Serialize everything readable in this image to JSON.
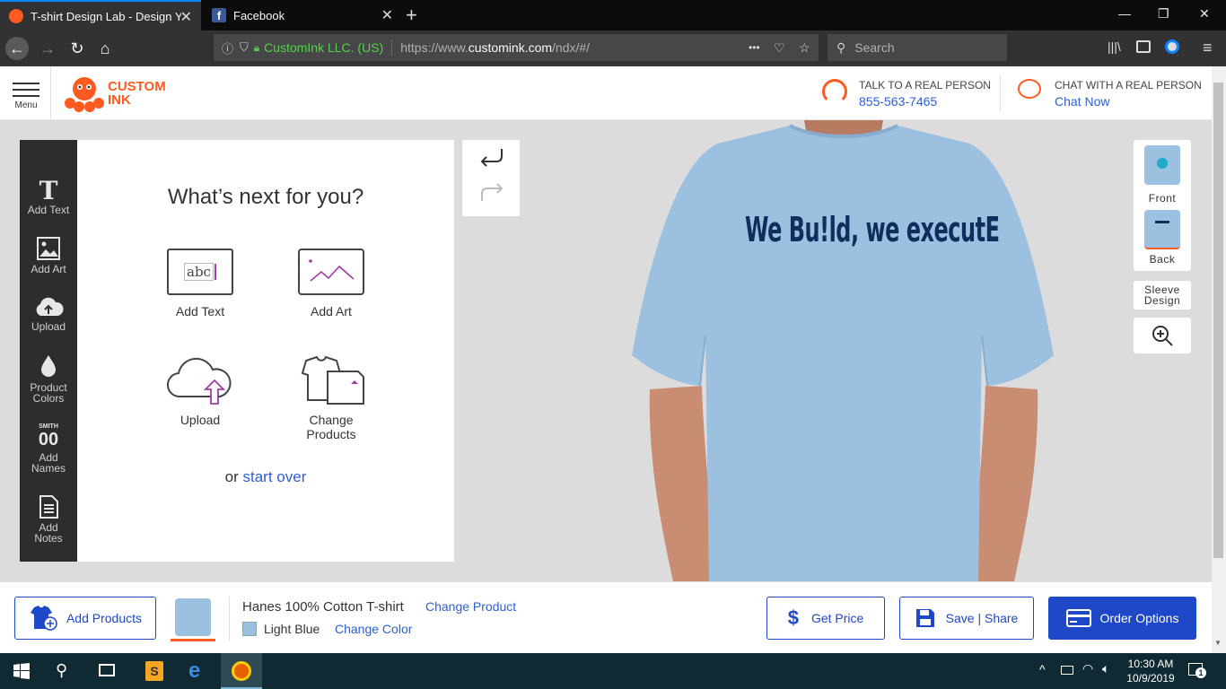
{
  "browser": {
    "tabs": [
      {
        "title": "T-shirt Design Lab - Design You",
        "active": true
      },
      {
        "title": "Facebook",
        "active": false
      }
    ],
    "site_identity": "CustomInk LLC. (US)",
    "url_prefix": "https://www.",
    "url_domain": "customink.com",
    "url_path": "/ndx/#/",
    "url_menu_dots": "•••",
    "search_placeholder": "Search"
  },
  "header": {
    "menu_label": "Menu",
    "logo_line1": "CUSTOM",
    "logo_line2": "INK",
    "talk_label": "TALK TO A REAL PERSON",
    "phone": "855-563-7465",
    "chat_label": "CHAT WITH A REAL PERSON",
    "chat_link": "Chat Now"
  },
  "tools": [
    {
      "label1": "Add Text",
      "label2": "",
      "icon": "text-icon"
    },
    {
      "label1": "Add Art",
      "label2": "",
      "icon": "image-icon"
    },
    {
      "label1": "Upload",
      "label2": "",
      "icon": "cloud-upload-icon"
    },
    {
      "label1": "Product",
      "label2": "Colors",
      "icon": "droplet-icon"
    },
    {
      "label1": "Add",
      "label2": "Names",
      "icon": "names-number-icon",
      "badge": "SMITH",
      "digits": "00"
    },
    {
      "label1": "Add",
      "label2": "Notes",
      "icon": "notes-icon"
    }
  ],
  "panel": {
    "title": "What’s next for you?",
    "abc_sample": "abc",
    "options": [
      {
        "label": "Add Text"
      },
      {
        "label": "Add Art"
      },
      {
        "label": "Upload"
      },
      {
        "label1": "Change",
        "label2": "Products"
      }
    ],
    "or_text": "or",
    "start_over": "start over"
  },
  "shirt": {
    "design_text": "We Bu!ld, we executE",
    "color": "#9cc0df"
  },
  "views": {
    "front": "Front",
    "back": "Back",
    "sleeve1": "Sleeve",
    "sleeve2": "Design"
  },
  "bottom": {
    "add_products": "Add Products",
    "product_name": "Hanes 100% Cotton T-shirt",
    "change_product": "Change Product",
    "color_name": "Light Blue",
    "change_color": "Change Color",
    "get_price": "Get Price",
    "save_share": "Save | Share",
    "order_options": "Order Options"
  },
  "taskbar": {
    "time": "10:30 AM",
    "date": "10/9/2019",
    "notifications": "1"
  },
  "colors": {
    "brand_orange": "#ff5a1f",
    "link_blue": "#2d5fd3",
    "order_blue": "#1e48c7",
    "shirt_blue": "#9cc0df"
  }
}
